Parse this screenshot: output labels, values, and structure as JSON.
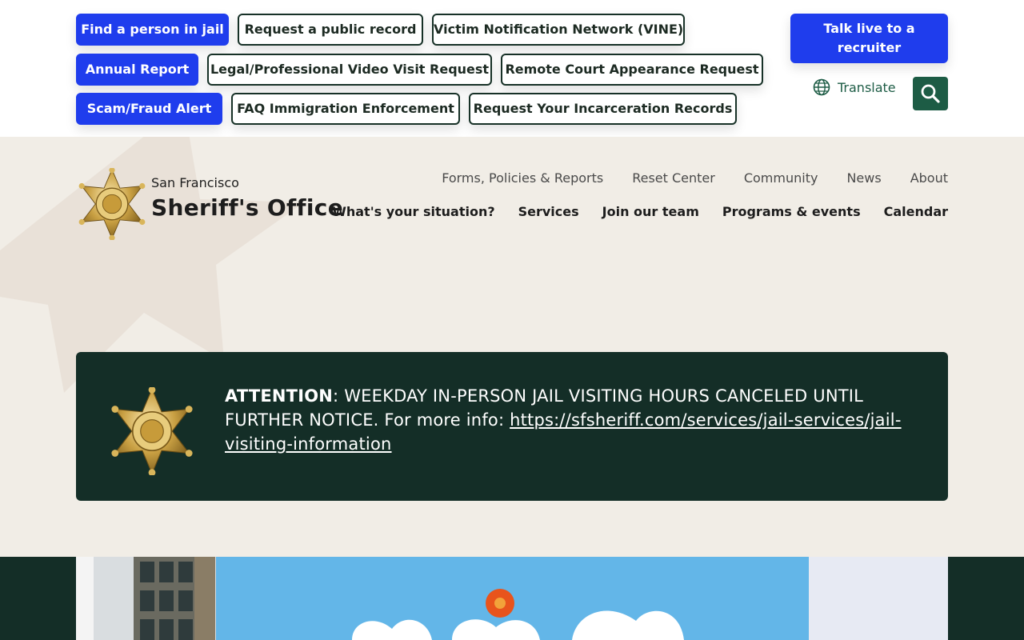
{
  "quick_links": {
    "row1": [
      "Find a person in jail",
      "Request a public record",
      "Victim Notification Network (VINE)"
    ],
    "row2": [
      "Annual Report",
      "Legal/Professional Video Visit Request",
      "Remote Court Appearance Request"
    ],
    "row3": [
      "Scam/Fraud Alert",
      "FAQ Immigration Enforcement",
      "Request Your Incarceration Records"
    ]
  },
  "recruiter_button": "Talk live to a recruiter",
  "translate_label": "Translate",
  "brand": {
    "city": "San Francisco",
    "name": "Sheriff's Office"
  },
  "util_nav": [
    "Forms, Policies & Reports",
    "Reset Center",
    "Community",
    "News",
    "About"
  ],
  "main_nav": [
    "What's your situation?",
    "Services",
    "Join our team",
    "Programs & events",
    "Calendar"
  ],
  "alert": {
    "label": "ATTENTION",
    "message": ": WEEKDAY IN-PERSON JAIL VISITING HOURS CANCELED UNTIL FURTHER NOTICE. For more info: ",
    "link": "https://sfsheriff.com/services/jail-services/jail-visiting-information"
  },
  "colors": {
    "primary_blue": "#1f3ded",
    "dark_green": "#142e27",
    "brand_green": "#1d5c45",
    "header_bg": "#f1ede6"
  },
  "icons": [
    "globe-icon",
    "search-icon",
    "sheriff-badge-icon"
  ]
}
